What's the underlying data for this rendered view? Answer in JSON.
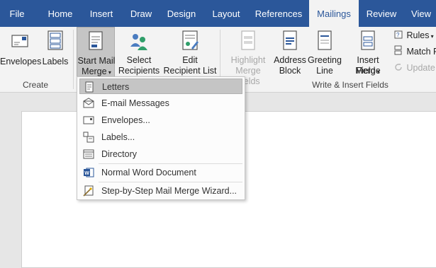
{
  "tabs": [
    {
      "label": "File"
    },
    {
      "label": "Home"
    },
    {
      "label": "Insert"
    },
    {
      "label": "Draw"
    },
    {
      "label": "Design"
    },
    {
      "label": "Layout"
    },
    {
      "label": "References"
    },
    {
      "label": "Mailings",
      "active": true
    },
    {
      "label": "Review"
    },
    {
      "label": "View"
    }
  ],
  "ribbon": {
    "envelopes": "Envelopes",
    "labels": "Labels",
    "start_mail_merge": [
      "Start Mail",
      "Merge"
    ],
    "select_recipients": [
      "Select",
      "Recipients"
    ],
    "edit_recipient_list": [
      "Edit",
      "Recipient List"
    ],
    "highlight_merge_fields": [
      "Highlight",
      "Merge Fields"
    ],
    "address_block": [
      "Address",
      "Block"
    ],
    "greeting_line": [
      "Greeting",
      "Line"
    ],
    "insert_merge_field": [
      "Insert Merge",
      "Field"
    ],
    "rules": "Rules",
    "match_fields": "Match F",
    "update_labels": "Update",
    "groups": {
      "create": "Create",
      "write_insert_fields": "Write & Insert Fields"
    }
  },
  "dropdown": {
    "items": [
      {
        "label": "Letters",
        "icon": "letter-icon"
      },
      {
        "label": "E-mail Messages",
        "icon": "email-icon"
      },
      {
        "label": "Envelopes...",
        "icon": "envelope-icon"
      },
      {
        "label": "Labels...",
        "icon": "labels-icon"
      },
      {
        "label": "Directory",
        "icon": "directory-icon"
      },
      {
        "label": "Normal Word Document",
        "icon": "word-doc-icon"
      },
      {
        "label": "Step-by-Step Mail Merge Wizard...",
        "icon": "wizard-icon"
      }
    ]
  },
  "colors": {
    "brand": "#2b579a",
    "ribbon": "#f3f3f3",
    "pressed": "#c5c5c5"
  }
}
